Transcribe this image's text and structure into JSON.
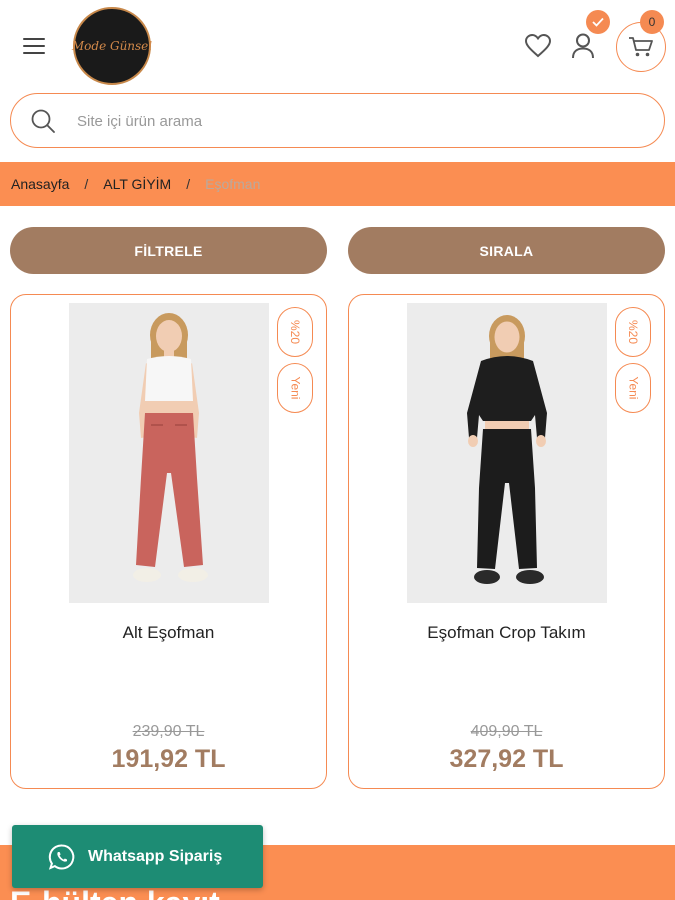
{
  "header": {
    "logo_text": "Mode Günsel",
    "cart_count": "0"
  },
  "search": {
    "placeholder": "Site içi ürün arama",
    "value": ""
  },
  "breadcrumb": {
    "items": [
      "Anasayfa",
      "ALT GİYİM",
      "Eşofman"
    ],
    "separator": "/"
  },
  "actions": {
    "filter_label": "FİLTRELE",
    "sort_label": "SIRALA"
  },
  "products": [
    {
      "name": "Alt Eşofman",
      "tags": [
        "%20",
        "Yeni"
      ],
      "old_price": "239,90 TL",
      "new_price": "191,92 TL",
      "top_color": "#f4f4f4",
      "bottom_color": "#c9645d"
    },
    {
      "name": "Eşofman Crop Takım",
      "tags": [
        "%20",
        "Yeni"
      ],
      "old_price": "409,90 TL",
      "new_price": "327,92 TL",
      "top_color": "#1c1c1c",
      "bottom_color": "#1c1c1c"
    }
  ],
  "whatsapp": {
    "label": "Whatsapp Sipariş"
  },
  "footer": {
    "newsletter_title": "E-bülten kayıt"
  },
  "colors": {
    "accent": "#fb8e52",
    "brown": "#a27c61",
    "whatsapp_green": "#1d8c74"
  }
}
